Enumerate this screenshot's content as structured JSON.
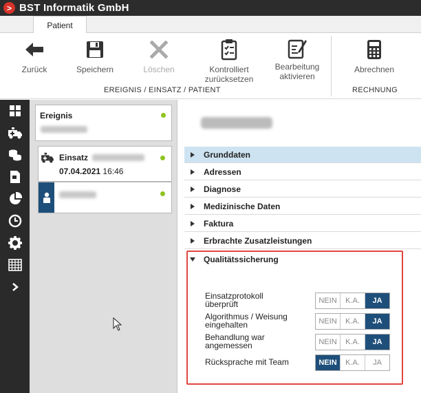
{
  "app": {
    "title": "BST Informatik GmbH",
    "logo_glyph": ">"
  },
  "tabs": [
    {
      "label": "Patient"
    }
  ],
  "ribbon": {
    "buttons": [
      {
        "label": "Zurück",
        "icon": "arrow-left-icon"
      },
      {
        "label": "Speichern",
        "icon": "floppy-disk-icon"
      },
      {
        "label": "Löschen",
        "icon": "close-x-icon",
        "disabled": true
      },
      {
        "label": "Kontrolliert zurücksetzen",
        "icon": "clipboard-check-icon"
      },
      {
        "label": "Bearbeitung aktivieren",
        "icon": "edit-form-icon"
      },
      {
        "label": "Abrechnen",
        "icon": "calculator-icon"
      }
    ],
    "groups": [
      "EREIGNIS / EINSATZ / PATIENT",
      "RECHNUNG"
    ]
  },
  "sidebar_icons": [
    "dashboard-grid-icon",
    "ambulance-icon",
    "coins-icon",
    "document-icon",
    "pie-chart-icon",
    "clock-icon",
    "gear-icon",
    "calendar-grid-icon",
    "chevron-right-icon"
  ],
  "middle": {
    "ereignis": {
      "label": "Ereignis"
    },
    "einsatz": {
      "label": "Einsatz",
      "date": "07.04.2021",
      "time": "16:46"
    }
  },
  "sections": [
    {
      "label": "Grunddaten",
      "active": true
    },
    {
      "label": "Adressen"
    },
    {
      "label": "Diagnose"
    },
    {
      "label": "Medizinische Daten"
    },
    {
      "label": "Faktura"
    },
    {
      "label": "Erbrachte Zusatzleistungen"
    },
    {
      "label": "Qualitätssicherung",
      "open": true
    }
  ],
  "quality": {
    "options": [
      "NEIN",
      "K.A.",
      "JA"
    ],
    "rows": [
      {
        "label_line1": "Einsatzprotokoll",
        "label_line2": "überprüft",
        "selected": "JA"
      },
      {
        "label_line1": "Algorithmus / Weisung",
        "label_line2": "eingehalten",
        "selected": "JA"
      },
      {
        "label_line1": "Behandlung war",
        "label_line2": "angemessen",
        "selected": "JA"
      },
      {
        "label_line1": "Rücksprache mit Team",
        "label_line2": "",
        "selected": "NEIN"
      }
    ]
  },
  "colors": {
    "accent": "#1e4f7a",
    "highlight_border": "#e0453e",
    "status_dot": "#8fc31f",
    "active_section": "#cde3f1"
  }
}
